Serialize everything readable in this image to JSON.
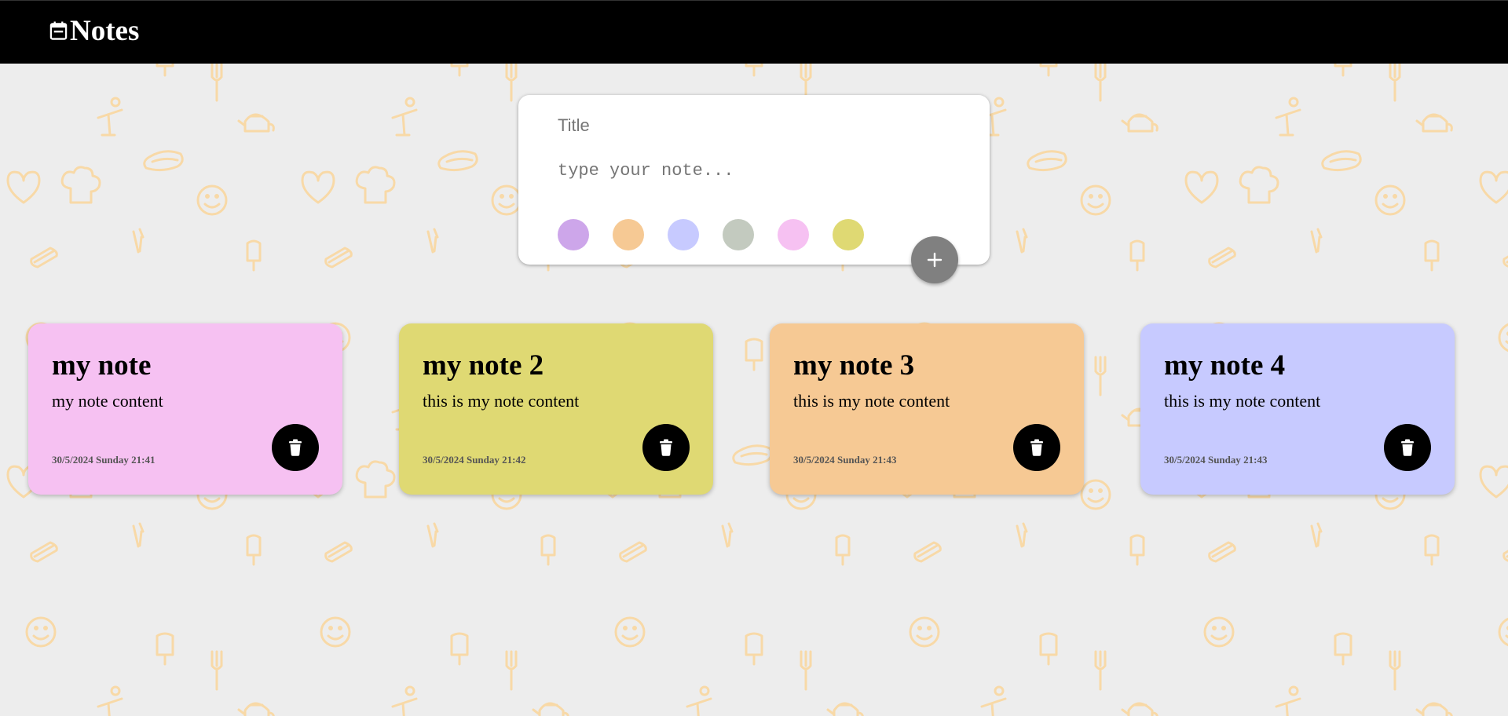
{
  "header": {
    "logo_icon": "notes-calendar-icon",
    "title": "Notes"
  },
  "composer": {
    "title_placeholder": "Title",
    "note_placeholder": "type your note...",
    "swatches": [
      {
        "color": "#cda6ea"
      },
      {
        "color": "#f6c994"
      },
      {
        "color": "#c7caff"
      },
      {
        "color": "#c3cabf"
      },
      {
        "color": "#f6c1f2"
      },
      {
        "color": "#dfd973"
      }
    ],
    "add_icon": "plus-icon"
  },
  "notes": [
    {
      "title": "my note",
      "content": "my note content",
      "date": "30/5/2024 Sunday 21:41",
      "color": "#f6c1f2"
    },
    {
      "title": "my note 2",
      "content": "this is my note content",
      "date": "30/5/2024 Sunday 21:42",
      "color": "#dfd973"
    },
    {
      "title": "my note 3",
      "content": "this is my note content",
      "date": "30/5/2024 Sunday 21:43",
      "color": "#f6c994"
    },
    {
      "title": "my note 4",
      "content": "this is my note content",
      "date": "30/5/2024 Sunday 21:43",
      "color": "#c7caff"
    }
  ],
  "colors": {
    "background": "#ededed",
    "pattern": "#f8d9a7",
    "header": "#000000",
    "add_button": "#808080",
    "delete_button": "#000000"
  }
}
